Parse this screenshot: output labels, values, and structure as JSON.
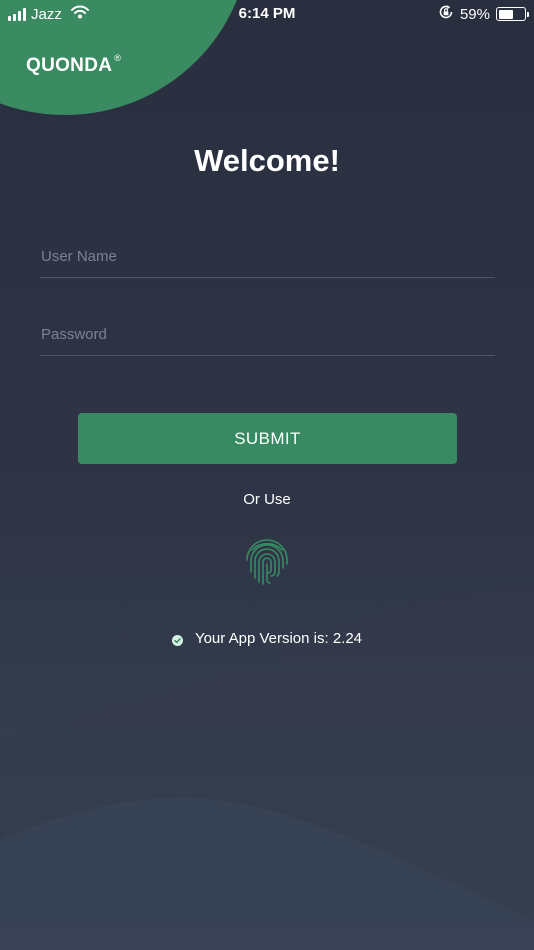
{
  "status_bar": {
    "carrier": "Jazz",
    "time": "6:14 PM",
    "battery_percent": "59%",
    "battery_level": 0.59,
    "icons": [
      "signal-bars-icon",
      "wifi-icon",
      "orientation-lock-icon",
      "battery-icon"
    ]
  },
  "brand": {
    "name": "QUONDA",
    "mark": "®"
  },
  "login": {
    "title": "Welcome!",
    "username_placeholder": "User Name",
    "password_placeholder": "Password",
    "submit_label": "SUBMIT",
    "alt_text": "Or Use",
    "alt_icon": "fingerprint-icon"
  },
  "version": {
    "text": "Your App Version is: 2.24",
    "icon": "check-circle-icon"
  },
  "colors": {
    "accent": "#378a62",
    "background": "#2c3142",
    "text": "#ffffff",
    "placeholder": "#7b8292"
  }
}
